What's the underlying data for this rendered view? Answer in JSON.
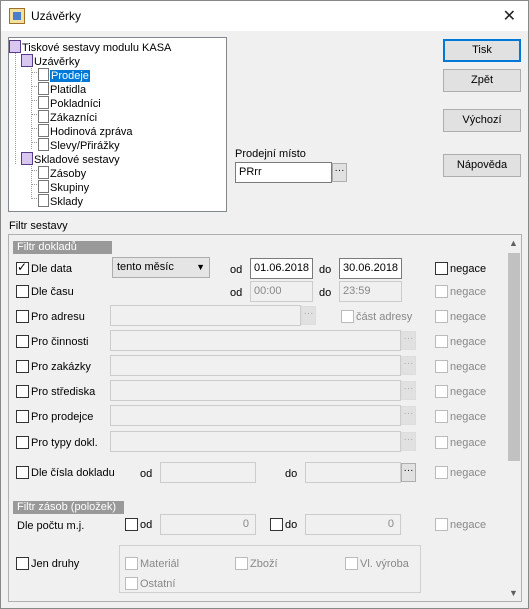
{
  "window": {
    "title": "Uzávěrky"
  },
  "tree": {
    "root": "Tiskové sestavy modulu KASA",
    "group1": "Uzávěrky",
    "items1": [
      "Prodeje",
      "Platidla",
      "Pokladníci",
      "Zákazníci",
      "Hodinová zpráva",
      "Slevy/Přirážky"
    ],
    "group2": "Skladové sestavy",
    "items2": [
      "Zásoby",
      "Skupiny",
      "Sklady"
    ]
  },
  "buttons": {
    "print": "Tisk",
    "back": "Zpět",
    "default": "Výchozí",
    "help": "Nápověda"
  },
  "sale_place": {
    "label": "Prodejní místo",
    "value": "PRrr"
  },
  "filter": {
    "title": "Filtr sestavy",
    "docs_header": "Filtr dokladů",
    "by_date": {
      "label": "Dle data",
      "period": "tento měsíc",
      "from_label": "od",
      "from": "01.06.2018",
      "to_label": "do",
      "to": "30.06.2018",
      "neg": "negace"
    },
    "by_time": {
      "label": "Dle času",
      "from_label": "od",
      "from": "00:00",
      "to_label": "do",
      "to": "23:59",
      "neg": "negace"
    },
    "address": {
      "label": "Pro adresu",
      "part": "část adresy",
      "neg": "negace"
    },
    "activity": {
      "label": "Pro činnosti",
      "neg": "negace"
    },
    "order": {
      "label": "Pro zakázky",
      "neg": "negace"
    },
    "center": {
      "label": "Pro střediska",
      "neg": "negace"
    },
    "seller": {
      "label": "Pro prodejce",
      "neg": "negace"
    },
    "doc_types": {
      "label": "Pro typy dokl.",
      "neg": "negace"
    },
    "doc_number": {
      "label": "Dle čísla dokladu",
      "from_label": "od",
      "to_label": "do",
      "neg": "negace"
    },
    "stock_header": "Filtr zásob (položek)",
    "qty": {
      "label": "Dle počtu m.j.",
      "from_label": "od",
      "from": "0",
      "to_label": "do",
      "to": "0",
      "neg": "negace"
    },
    "kinds": {
      "label": "Jen druhy",
      "material": "Materiál",
      "goods": "Zboží",
      "own": "Vl. výroba",
      "other": "Ostatní"
    }
  }
}
